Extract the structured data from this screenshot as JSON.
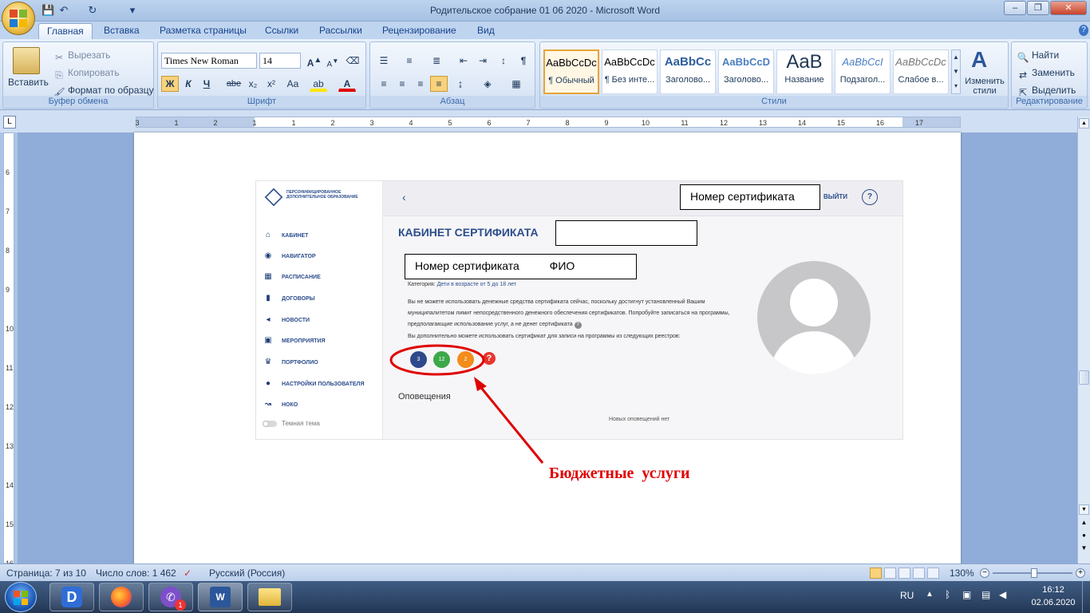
{
  "window": {
    "title": "Родительское собрание 01 06 2020  -  Microsoft Word",
    "minimize": "–",
    "maximize": "❐",
    "close": "✕"
  },
  "qat": {
    "save": "💾",
    "undo": "↶",
    "redo": "↻",
    "customize": "▾"
  },
  "tabs": [
    "Главная",
    "Вставка",
    "Разметка страницы",
    "Ссылки",
    "Рассылки",
    "Рецензирование",
    "Вид"
  ],
  "ribbon": {
    "clipboard": {
      "label": "Буфер обмена",
      "paste": "Вставить",
      "cut": "Вырезать",
      "copy": "Копировать",
      "format_painter": "Формат по образцу"
    },
    "font": {
      "label": "Шрифт",
      "font_name": "Times New Roman",
      "font_size": "14",
      "bold": "Ж",
      "italic": "К",
      "underline": "Ч",
      "strike": "abe",
      "subscript": "x₂",
      "superscript": "x²",
      "change_case": "Aa"
    },
    "paragraph": {
      "label": "Абзац",
      "pilcrow": "¶"
    },
    "styles": {
      "label": "Стили",
      "items": [
        {
          "sample": "AaBbCcDc",
          "name": "¶ Обычный"
        },
        {
          "sample": "AaBbCcDc",
          "name": "¶ Без инте..."
        },
        {
          "sample": "AaBbCc",
          "name": "Заголово..."
        },
        {
          "sample": "AaBbCcD",
          "name": "Заголово..."
        },
        {
          "sample": "AaB",
          "name": "Название"
        },
        {
          "sample": "AaBbCcI",
          "name": "Подзагол..."
        },
        {
          "sample": "AaBbCcDc",
          "name": "Слабое в..."
        }
      ],
      "change_styles": "Изменить стили"
    },
    "editing": {
      "label": "Редактирование",
      "find": "Найти",
      "replace": "Заменить",
      "select": "Выделить"
    }
  },
  "ruler": {
    "ticks": [
      "3",
      "1",
      "2",
      "1",
      "1",
      "2",
      "3",
      "4",
      "5",
      "6",
      "7",
      "8",
      "9",
      "10",
      "11",
      "12",
      "13",
      "14",
      "15",
      "16",
      "17"
    ]
  },
  "vruler": {
    "ticks": [
      "6",
      "7",
      "8",
      "9",
      "10",
      "11",
      "12",
      "13",
      "14",
      "15",
      "16"
    ]
  },
  "shot": {
    "logo_text": "ПЕРСОНИФИЦИРОВАННОЕ ДОПОЛНИТЕЛЬНОЕ ОБРАЗОВАНИЕ",
    "back": "‹",
    "logout": "ВЫЙТИ",
    "help": "?",
    "heading": "КАБИНЕТ СЕРТИФИКАТА",
    "category_label": "Категория:",
    "category_value": "Дети в возрасте от 5 до 18 лет",
    "paragraph1": "Вы не можете использовать денежные средства сертификата сейчас, поскольку достигнут установленный Вашим муниципалитетом лимит непосредственного денежного обеспечения сертификатов. Попробуйте записаться на программы, предполагающие использование услуг, а не денег сертификата",
    "paragraph2": "Вы дополнительно можете использовать сертификат для записи на программы из следующих реестров:",
    "registries": [
      {
        "count": "3",
        "color": "#2f4a8a"
      },
      {
        "count": "12",
        "color": "#3da84a"
      },
      {
        "count": "2",
        "color": "#f28c1a"
      }
    ],
    "notifications_title": "Оповещения",
    "no_notifications": "Новых оповещений нет",
    "dark_theme": "Темная тема",
    "menu": [
      "КАБИНЕТ",
      "НАВИГАТОР",
      "РАСПИСАНИЕ",
      "ДОГОВОРЫ",
      "НОВОСТИ",
      "МЕРОПРИЯТИЯ",
      "ПОРТФОЛИО",
      "НАСТРОЙКИ ПОЛЬЗОВАТЕЛЯ",
      "НОКО"
    ]
  },
  "overlays": {
    "box_top": "Номер сертификата",
    "box_mid_a": "Номер сертификата",
    "box_mid_b": "ФИО",
    "callout": "Бюджетные  услуги"
  },
  "status": {
    "page": "Страница: 7 из 10",
    "words": "Число слов: 1 462",
    "lang": "Русский (Россия)",
    "zoom": "130%"
  },
  "taskbar": {
    "lang": "RU",
    "time": "16:12",
    "date": "02.06.2020",
    "viber_badge": "1"
  },
  "colors": {
    "accent": "#2b579a",
    "callout": "#e00000"
  }
}
